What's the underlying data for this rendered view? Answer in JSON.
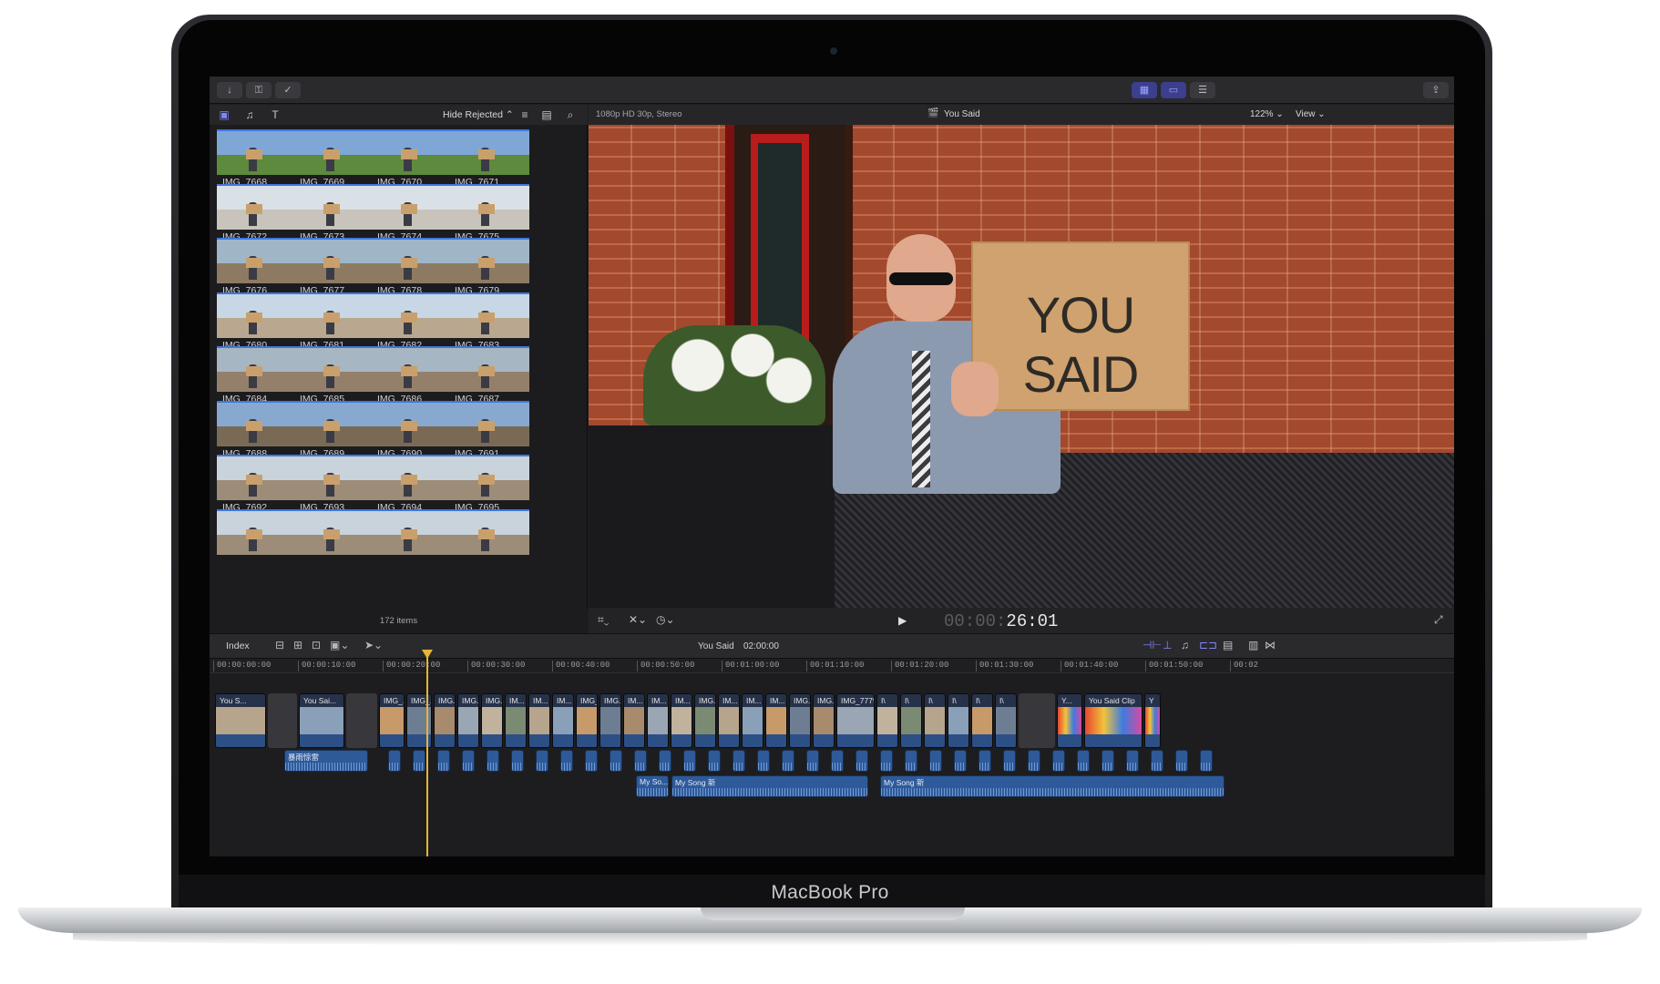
{
  "device": {
    "label": "MacBook Pro"
  },
  "browser": {
    "filter_label": "Hide Rejected",
    "item_count": "172 items",
    "clips": [
      "IMG_7668",
      "IMG_7669",
      "IMG_7670",
      "IMG_7671",
      "IMG_7672",
      "IMG_7673",
      "IMG_7674",
      "IMG_7675",
      "IMG_7676",
      "IMG_7677",
      "IMG_7678",
      "IMG_7679",
      "IMG_7680",
      "IMG_7681",
      "IMG_7682",
      "IMG_7683",
      "IMG_7684",
      "IMG_7685",
      "IMG_7686",
      "IMG_7687",
      "IMG_7688",
      "IMG_7689",
      "IMG_7690",
      "IMG_7691",
      "IMG_7692",
      "IMG_7693",
      "IMG_7694",
      "IMG_7695",
      "",
      "",
      "",
      ""
    ]
  },
  "viewer": {
    "format": "1080p HD 30p, Stereo",
    "title": "You Said",
    "zoom": "122%",
    "view_menu": "View",
    "sign_text": "YOU SAID",
    "timecode_dim": "00:00:",
    "timecode": "26:01"
  },
  "timeline": {
    "index_label": "Index",
    "project_name": "You Said",
    "duration": "02:00:00",
    "ruler": [
      "00:00:00:00",
      "00:00:10:00",
      "00:00:20:00",
      "00:00:30:00",
      "00:00:40:00",
      "00:00:50:00",
      "00:01:00:00",
      "00:01:10:00",
      "00:01:20:00",
      "00:01:30:00",
      "00:01:40:00",
      "00:01:50:00",
      "00:02"
    ],
    "video_clips": [
      "You S...",
      "You Sai...",
      "IMG_...",
      "IMG_...",
      "IMG...",
      "IMG...",
      "IMG...",
      "IM...",
      "IM...",
      "IM...",
      "IMG_7...",
      "IMG...",
      "IM...",
      "IM...",
      "IM...",
      "IMG...",
      "IM...",
      "IM...",
      "IM...",
      "IMG...",
      "IMG...",
      "IMG_7779",
      "I\\",
      "I\\",
      "I\\",
      "I\\",
      "I\\",
      "I\\",
      "Y...",
      "You Said Clip",
      "Y"
    ],
    "audio_clips": {
      "connected": "暴雨惊雷",
      "song_a": "My So...",
      "song_b": "My Song 新",
      "song_c": "My Song 新"
    }
  },
  "colors": {
    "accent": "#3b3f8e",
    "playhead": "#e7b533",
    "audio": "#2e5a9a"
  }
}
